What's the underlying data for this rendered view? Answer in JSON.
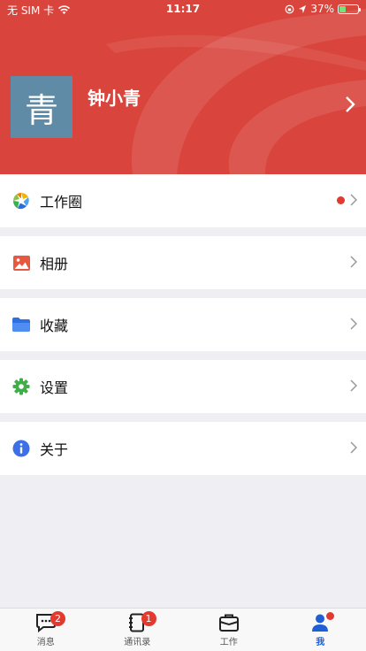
{
  "status_bar": {
    "carrier": "无 SIM 卡",
    "time": "11:17",
    "battery": "37%",
    "battery_level": 0.37
  },
  "profile": {
    "avatar_text": "青",
    "name": "钟小青"
  },
  "menu": [
    {
      "label": "工作圈",
      "icon": "moments-icon",
      "has_dot": true
    },
    {
      "label": "相册",
      "icon": "photo-album-icon"
    },
    {
      "label": "收藏",
      "icon": "folder-icon"
    },
    {
      "label": "设置",
      "icon": "gear-icon"
    },
    {
      "label": "关于",
      "icon": "info-icon"
    }
  ],
  "tabs": [
    {
      "label": "消息",
      "icon": "chat-icon",
      "badge": "2"
    },
    {
      "label": "通讯录",
      "icon": "contacts-icon",
      "badge": "1"
    },
    {
      "label": "工作",
      "icon": "briefcase-icon"
    },
    {
      "label": "我",
      "icon": "person-icon",
      "active": true
    }
  ],
  "colors": {
    "header": "#d9453d",
    "accent": "#1f5fd6",
    "badge": "#e33a2f",
    "avatar": "#5f8ba6"
  }
}
